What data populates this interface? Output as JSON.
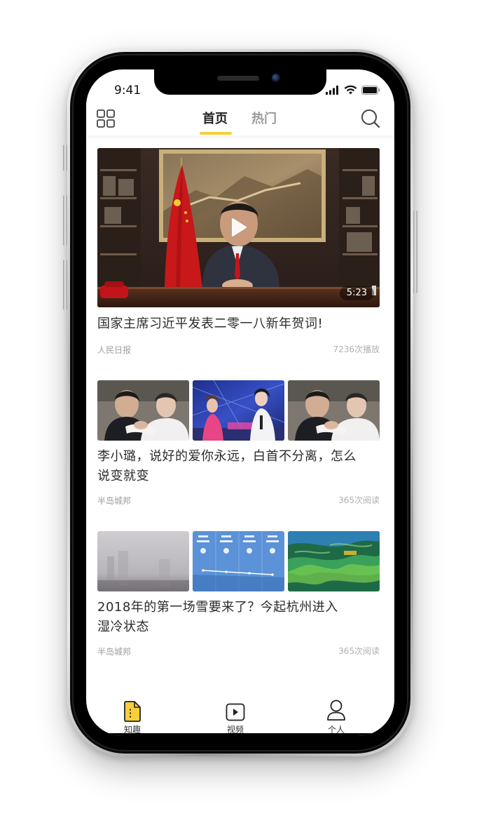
{
  "status_bar": {
    "time": "9:41"
  },
  "header": {
    "tabs": [
      {
        "label": "首页",
        "active": true
      },
      {
        "label": "热门",
        "active": false
      }
    ]
  },
  "feed": {
    "video": {
      "title": "国家主席习近平发表二零一八新年贺词!",
      "source": "人民日报",
      "stats": "7236次播放",
      "duration": "5:23"
    },
    "articles": [
      {
        "title_line1": "李小璐，说好的爱你永远，白首不分离，怎么",
        "title_line2": "说变就变",
        "source": "半岛城邦",
        "stats": "365次阅读"
      },
      {
        "title_line1": "2018年的第一场雪要来了？今起杭州进入",
        "title_line2": "湿冷状态",
        "source": "半岛城邦",
        "stats": "365次阅读"
      }
    ]
  },
  "tabbar": {
    "items": [
      {
        "label": "知趣",
        "icon": "document-icon",
        "active": true
      },
      {
        "label": "视频",
        "icon": "video-icon",
        "active": false
      },
      {
        "label": "个人",
        "icon": "person-icon",
        "active": false
      }
    ]
  },
  "colors": {
    "accent": "#f6cf3a",
    "text_primary": "#2b2b2b",
    "text_secondary": "#9e9e9e"
  }
}
